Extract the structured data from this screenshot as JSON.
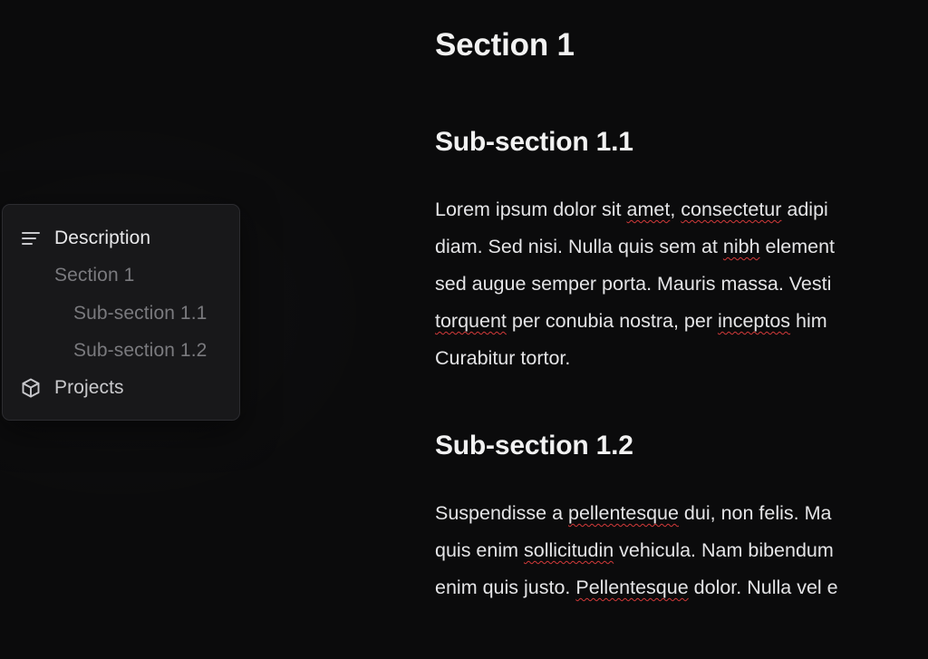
{
  "toc": {
    "items": [
      {
        "label": "Description",
        "icon": "lines-icon",
        "level": 0
      },
      {
        "label": "Section 1",
        "level": 1
      },
      {
        "label": "Sub-section 1.1",
        "level": 2
      },
      {
        "label": "Sub-section 1.2",
        "level": 2
      },
      {
        "label": "Projects",
        "icon": "cube-icon",
        "level": 0
      }
    ]
  },
  "article": {
    "title": "Section 1",
    "sub11": {
      "heading": "Sub-section 1.1",
      "lines": [
        [
          "Lorem ipsum dolor sit ",
          {
            "w": "amet"
          },
          ", ",
          {
            "w": "consectetur"
          },
          " adipi"
        ],
        [
          "diam. Sed nisi. Nulla quis sem at ",
          {
            "w": "nibh"
          },
          " element"
        ],
        [
          "sed augue semper porta. Mauris massa. Vesti"
        ],
        [
          {
            "w": "torquent"
          },
          " per conubia nostra, per ",
          {
            "w": "inceptos"
          },
          " him"
        ],
        [
          "Curabitur tortor."
        ]
      ]
    },
    "sub12": {
      "heading": "Sub-section 1.2",
      "lines": [
        [
          "Suspendisse a ",
          {
            "w": "pellentesque"
          },
          " dui, non felis. Ma"
        ],
        [
          "quis enim ",
          {
            "w": "sollicitudin"
          },
          " vehicula. Nam bibendum"
        ],
        [
          "enim quis justo. ",
          {
            "w": "Pellentesque"
          },
          " dolor. Nulla vel e"
        ]
      ]
    }
  },
  "colors": {
    "background": "#0b0b0c",
    "panel": "#18181a",
    "panel_border": "#2c2c30",
    "text": "#e4e4e6",
    "muted_text": "#7a7a7e",
    "spellcheck_underline": "#d23a3a"
  }
}
